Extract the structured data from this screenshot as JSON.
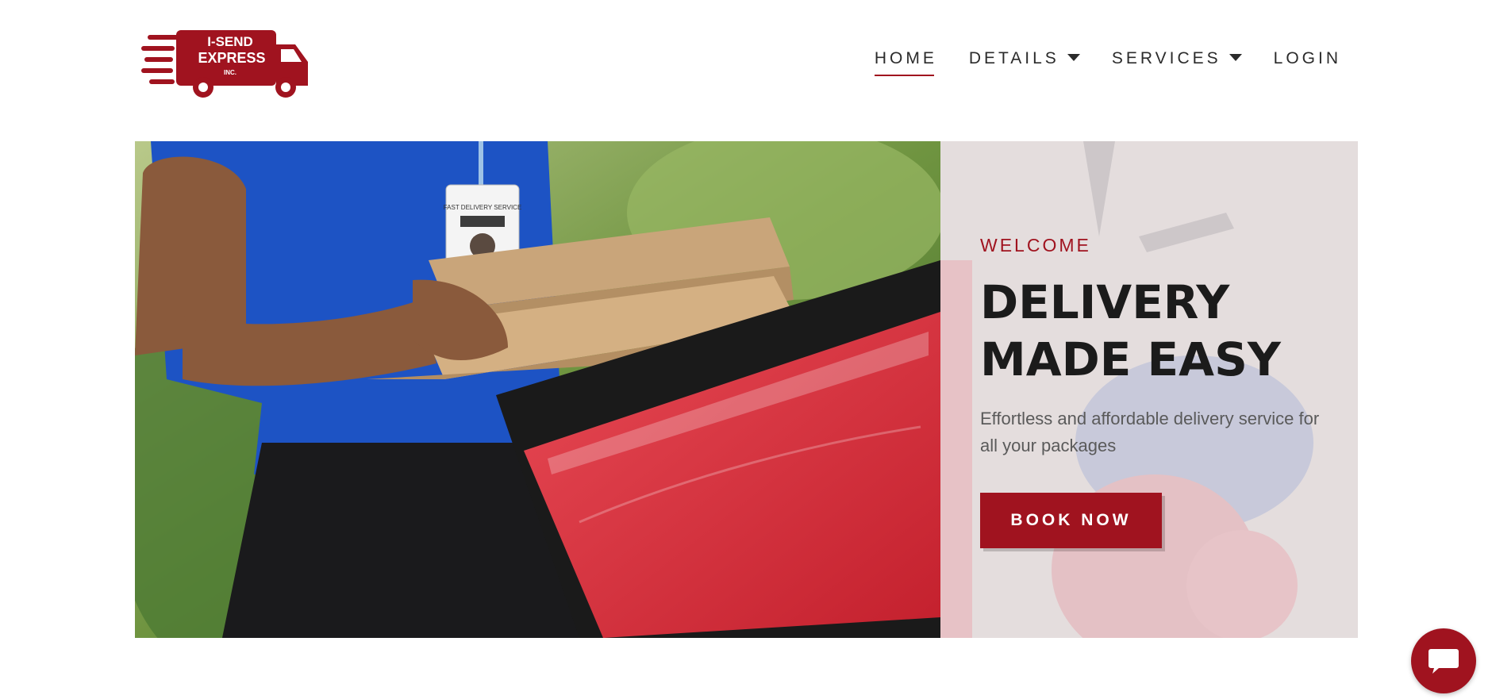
{
  "brand": {
    "logo_line1": "I-SEND",
    "logo_line2": "EXPRESS",
    "logo_line3": "INC.",
    "accent_color": "#a0131f"
  },
  "nav": {
    "items": [
      {
        "label": "HOME",
        "active": true,
        "has_dropdown": false
      },
      {
        "label": "DETAILS",
        "active": false,
        "has_dropdown": true
      },
      {
        "label": "SERVICES",
        "active": false,
        "has_dropdown": true
      },
      {
        "label": "LOGIN",
        "active": false,
        "has_dropdown": false
      }
    ]
  },
  "hero": {
    "badge_text": "FAST DELIVERY SERVICE",
    "eyebrow": "WELCOME",
    "headline_line1": "DELIVERY",
    "headline_line2": "MADE EASY",
    "subtext": "Effortless and affordable delivery service for all your packages",
    "cta_label": "BOOK NOW"
  },
  "chat": {
    "icon": "chat-bubble-icon"
  }
}
